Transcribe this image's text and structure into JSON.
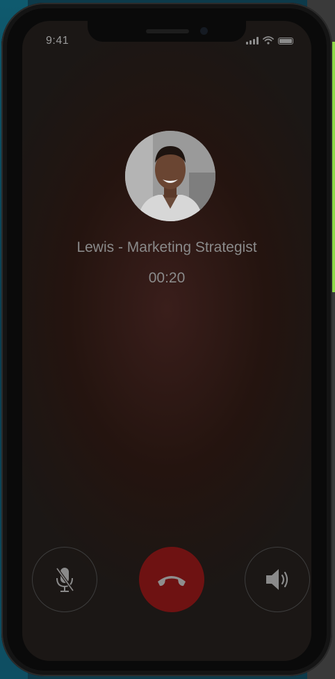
{
  "status_bar": {
    "time": "9:41"
  },
  "call": {
    "caller_name": "Lewis - Marketing Strategist",
    "duration": "00:20"
  },
  "controls": {
    "mute_icon": "microphone-off-icon",
    "end_icon": "phone-hangup-icon",
    "speaker_icon": "speaker-volume-icon"
  },
  "colors": {
    "end_call": "#6e1212",
    "accent_green": "#8fd94a"
  }
}
